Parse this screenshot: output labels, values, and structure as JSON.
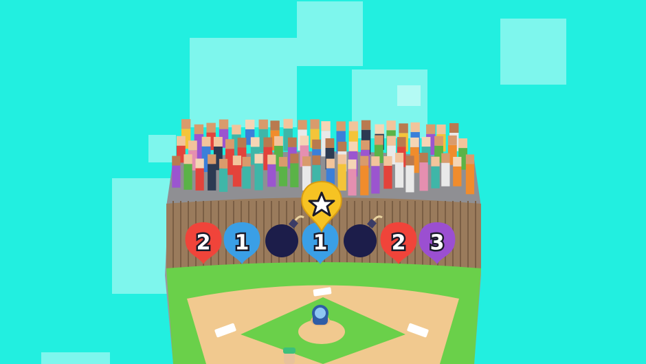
{
  "game": {
    "background_color": "#22efe0",
    "target_row": [
      {
        "kind": "number",
        "label": "2",
        "color": "#f0443a",
        "icon": "balloon"
      },
      {
        "kind": "number",
        "label": "1",
        "color": "#3a9fe6",
        "icon": "balloon"
      },
      {
        "kind": "bomb",
        "color": "#1c1d4a",
        "icon": "bomb-icon"
      },
      {
        "kind": "number",
        "label": "1",
        "color": "#3a9fe6",
        "icon": "balloon"
      },
      {
        "kind": "bomb",
        "color": "#1c1d4a",
        "icon": "bomb-icon"
      },
      {
        "kind": "number",
        "label": "2",
        "color": "#f0443a",
        "icon": "balloon"
      },
      {
        "kind": "number",
        "label": "3",
        "color": "#9b4fd1",
        "icon": "balloon"
      }
    ],
    "star_target": {
      "color": "#f6c323",
      "icon": "star-icon"
    },
    "field": {
      "grass_color": "#6ad04a",
      "dirt_color": "#f1c98f",
      "fence_color": "#9a7b5c",
      "stands_color": "#8f8f93"
    }
  }
}
